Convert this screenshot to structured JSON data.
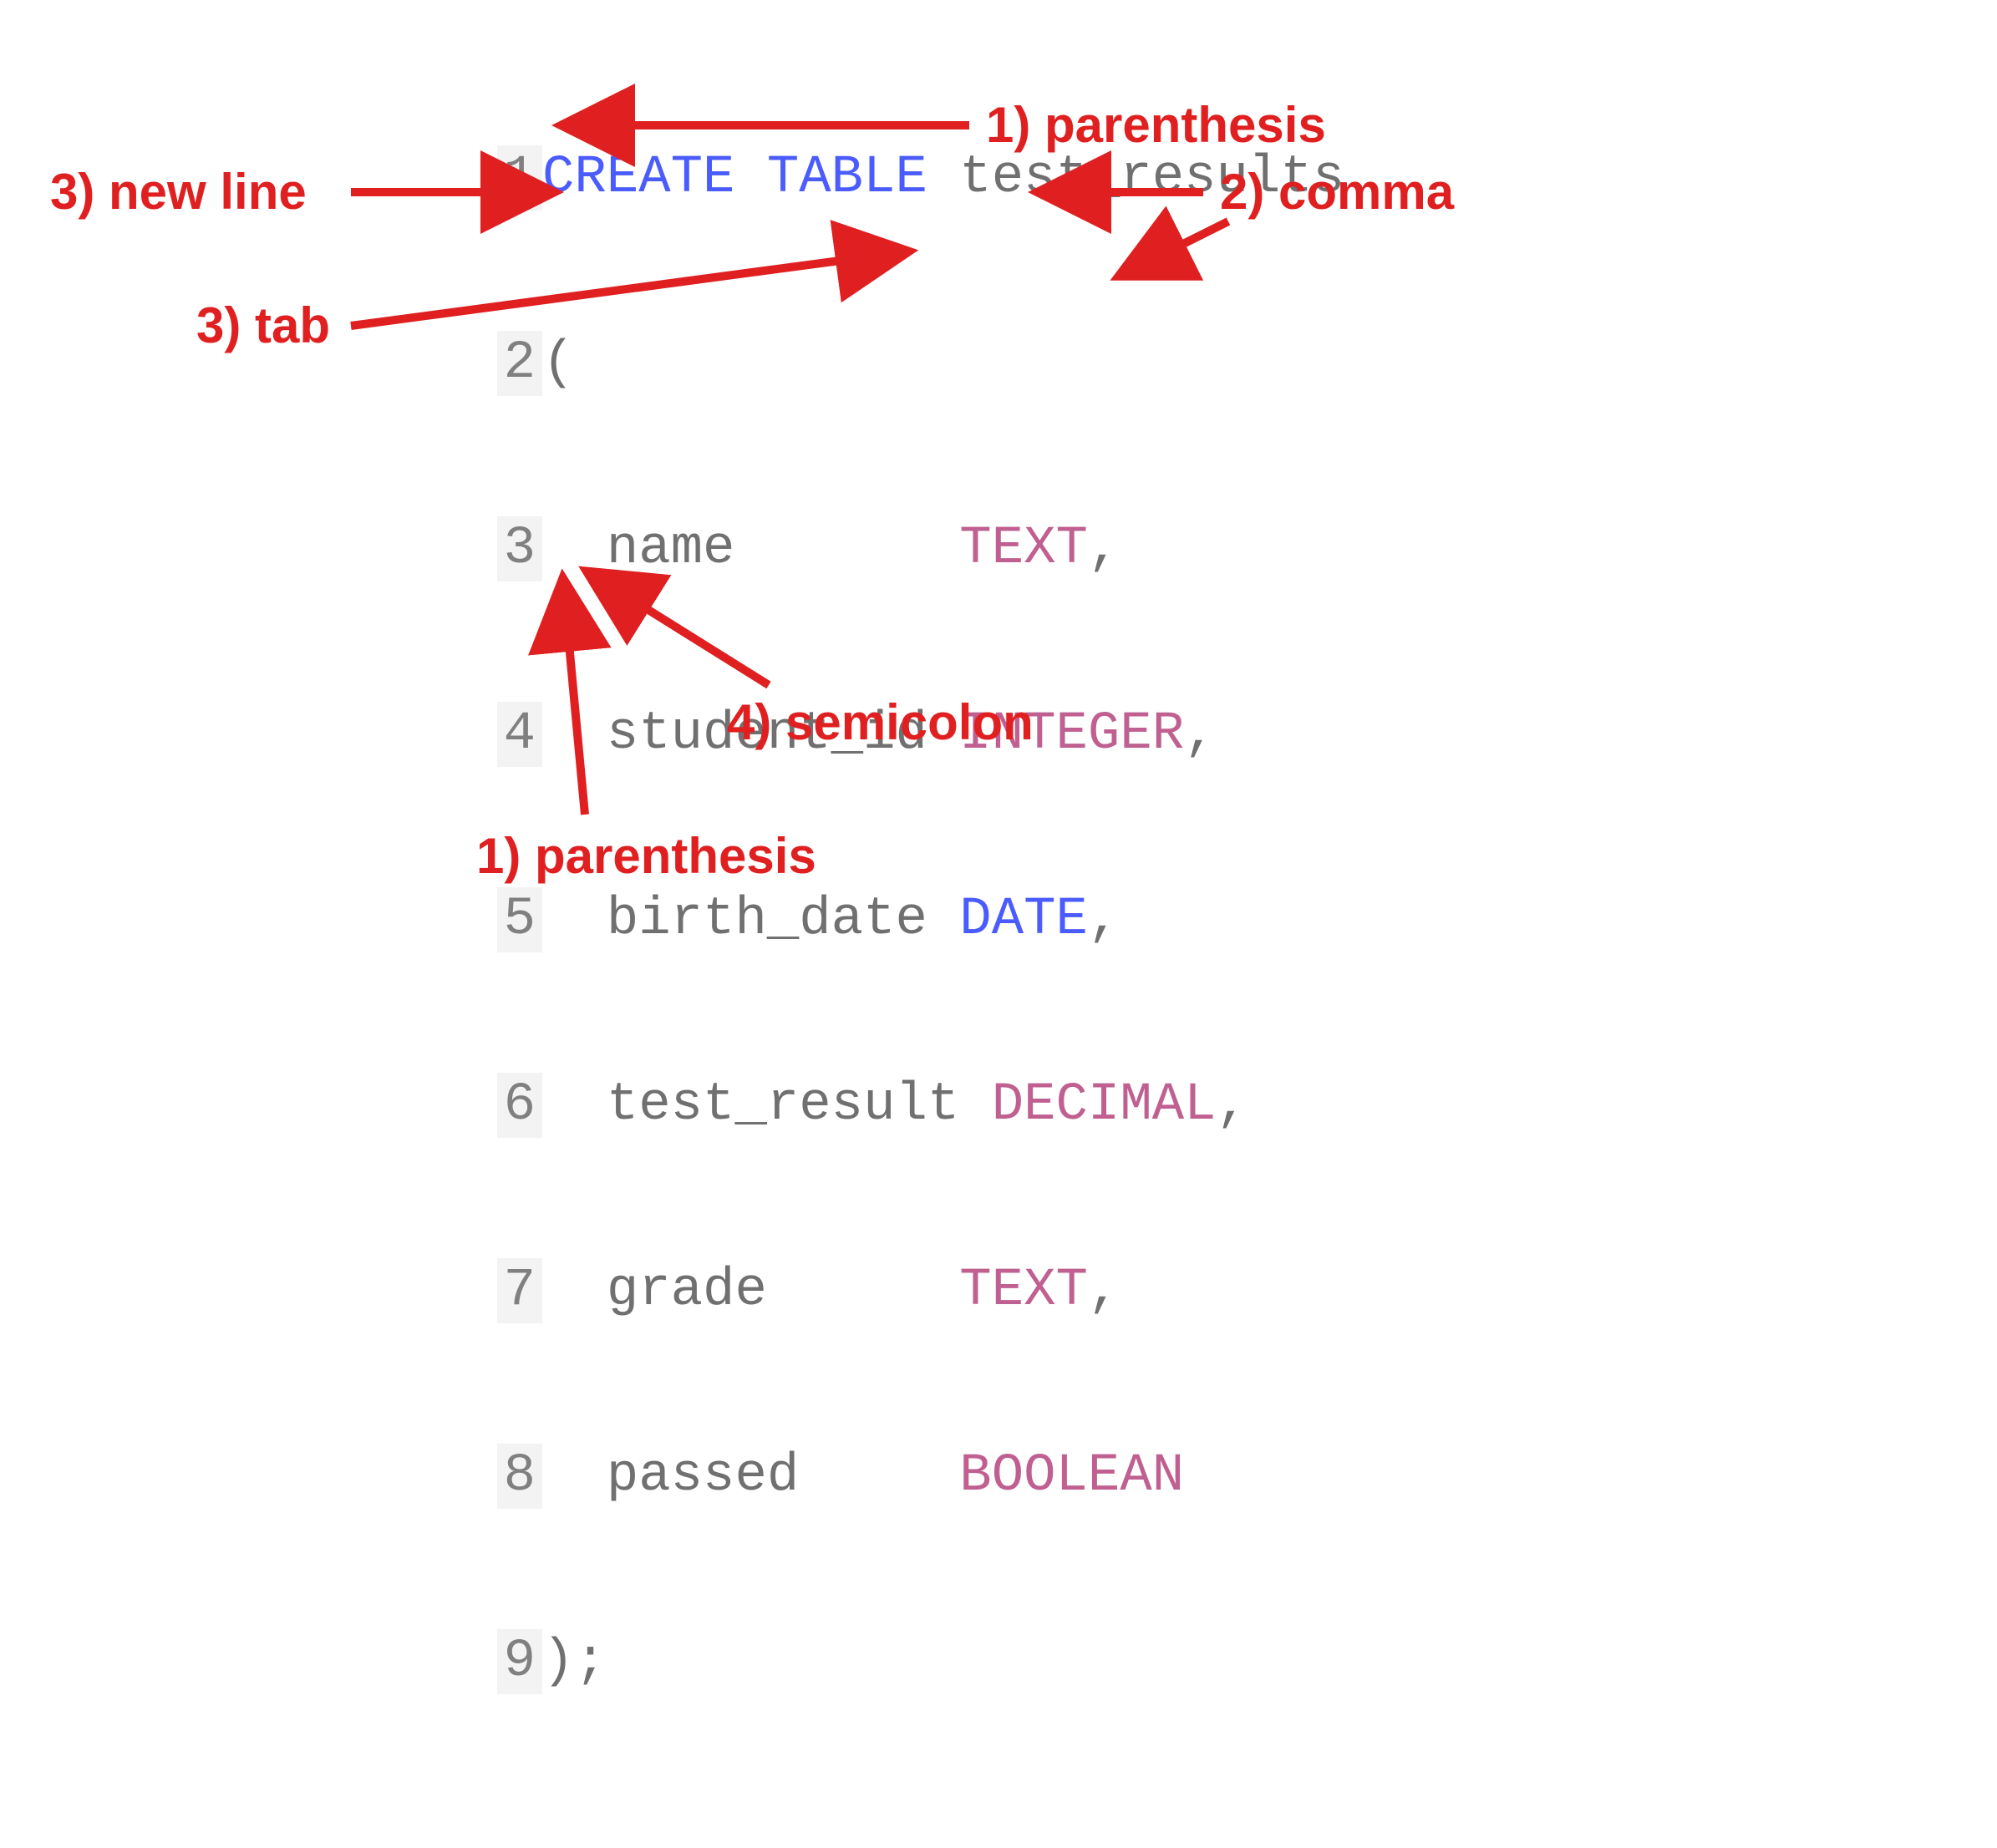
{
  "code": {
    "lineNumbers": [
      "1",
      "2",
      "3",
      "4",
      "5",
      "6",
      "7",
      "8",
      "9"
    ],
    "line1": {
      "kw1": "CREATE",
      "sp1": " ",
      "kw2": "TABLE",
      "sp2": " ",
      "ident": "test_results"
    },
    "line2": {
      "paren": "("
    },
    "line3": {
      "pad": "  ",
      "col": "name       ",
      "type": "TEXT",
      "comma": ","
    },
    "line4": {
      "pad": "  ",
      "col": "student_id ",
      "type": "INTEGER",
      "comma": ","
    },
    "line5": {
      "pad": "  ",
      "col": "birth_date ",
      "type": "DATE",
      "comma": ","
    },
    "line6": {
      "pad": "  ",
      "col": "test_result",
      "sp": " ",
      "type": "DECIMAL",
      "comma": ","
    },
    "line7": {
      "pad": "  ",
      "col": "grade      ",
      "type": "TEXT",
      "comma": ","
    },
    "line8": {
      "pad": "  ",
      "col": "passed     ",
      "type": "BOOLEAN"
    },
    "line9": {
      "close": ")",
      ";": ";"
    }
  },
  "annotations": {
    "parenthesis_top": "1) parenthesis",
    "comma": "2) comma",
    "newline": "3) new line",
    "tab": "3) tab",
    "semicolon": "4) semicolon",
    "parenthesis_bottom": "1) parenthesis"
  }
}
